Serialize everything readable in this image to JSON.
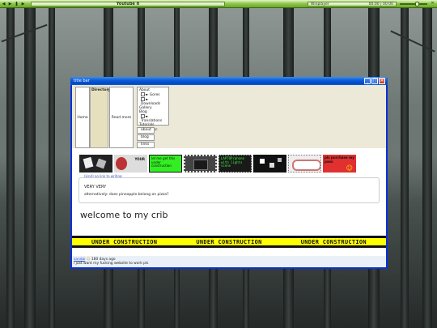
{
  "taskbar": {
    "title": "Youtube II",
    "player_label": "Winplayer",
    "time_elapsed": "00:00",
    "time_total": "00:00",
    "prev_icon": "prev-icon",
    "play_icon": "play-icon",
    "pause_icon": "pause-icon",
    "next_icon": "next-icon"
  },
  "window": {
    "title": "title bar",
    "accent": "#0a5ed6"
  },
  "nav": {
    "home": "Home",
    "directory": "Directory:",
    "read_more": "Read more",
    "menu": [
      {
        "label": "About",
        "sub": false
      },
      {
        "label": "Gores",
        "sub": true
      },
      {
        "label": "Downloads",
        "sub": true
      },
      {
        "label": "Gallery",
        "sub": false
      },
      {
        "label": "Blog",
        "sub": false
      },
      {
        "label": "Translations",
        "sub": true
      },
      {
        "label": "Tutorials",
        "sub": false
      },
      {
        "label": "Misc",
        "sub": true
      }
    ],
    "buttons": [
      "about",
      "blog",
      "links"
    ]
  },
  "thumbnails": [
    {
      "text": "",
      "bg": "#222"
    },
    {
      "text": "YOUR",
      "bg": "#dddddd"
    },
    {
      "text": "let me get this under construction",
      "bg": "#33ee22"
    },
    {
      "text": "",
      "bg": "#444"
    },
    {
      "text": "LAPTOP/phone with lights scene",
      "bg": "#1a1a1a"
    },
    {
      "text": "",
      "bg": "#111"
    },
    {
      "text": "",
      "bg": "#eeeeee"
    },
    {
      "text": "pls purchase my pass",
      "bg": "#e03030"
    }
  ],
  "caption": "(kind) no link to writing",
  "note": {
    "line1": "VERY VERY",
    "line2": "alternatively: does pineapple belong on pizza?"
  },
  "welcome": "welcome to my crib",
  "construction": [
    "UNDER CONSTRUCTION",
    "UNDER CONSTRUCTION",
    "UNDER CONSTRUCTION"
  ],
  "status": {
    "user": "sandai",
    "time": "180 days ago",
    "message": "i just want my fucking website to work pls"
  }
}
